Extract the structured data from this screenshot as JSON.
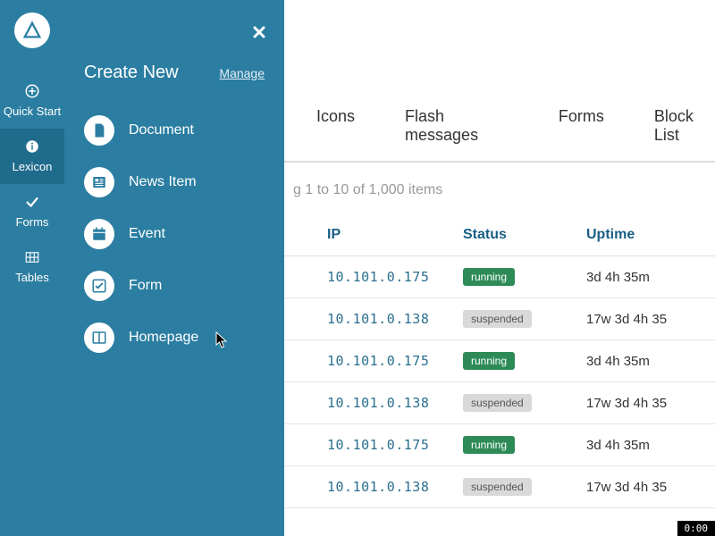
{
  "rail": [
    {
      "name": "quick-start",
      "label": "Quick Start",
      "icon": "plus-circle"
    },
    {
      "name": "lexicon",
      "label": "Lexicon",
      "icon": "info-circle",
      "active": true
    },
    {
      "name": "forms",
      "label": "Forms",
      "icon": "check"
    },
    {
      "name": "tables",
      "label": "Tables",
      "icon": "grid"
    }
  ],
  "flyout": {
    "title": "Create New",
    "manage": "Manage",
    "items": [
      {
        "name": "document",
        "label": "Document",
        "icon": "file"
      },
      {
        "name": "news-item",
        "label": "News Item",
        "icon": "news"
      },
      {
        "name": "event",
        "label": "Event",
        "icon": "calendar"
      },
      {
        "name": "form",
        "label": "Form",
        "icon": "check-square"
      },
      {
        "name": "homepage",
        "label": "Homepage",
        "icon": "columns"
      }
    ]
  },
  "tabs": [
    "Icons",
    "Flash messages",
    "Forms",
    "Block List"
  ],
  "listing_caption": "g 1 to 10 of 1,000 items",
  "headers": {
    "ip": "IP",
    "status": "Status",
    "uptime": "Uptime"
  },
  "rows": [
    {
      "ip": "10.101.0.175",
      "status": "running",
      "uptime": "3d 4h 35m"
    },
    {
      "ip": "10.101.0.138",
      "status": "suspended",
      "uptime": "17w 3d 4h 35"
    },
    {
      "ip": "10.101.0.175",
      "status": "running",
      "uptime": "3d 4h 35m"
    },
    {
      "ip": "10.101.0.138",
      "status": "suspended",
      "uptime": "17w 3d 4h 35"
    },
    {
      "ip": "10.101.0.175",
      "status": "running",
      "uptime": "3d 4h 35m"
    },
    {
      "ip": "10.101.0.138",
      "status": "suspended",
      "uptime": "17w 3d 4h 35"
    }
  ],
  "time_overlay": "0:00",
  "colors": {
    "teal": "#2B7EA1",
    "teal_dark": "#1F6B8C",
    "running": "#2E8B57",
    "suspended_bg": "#d9d9d9"
  }
}
